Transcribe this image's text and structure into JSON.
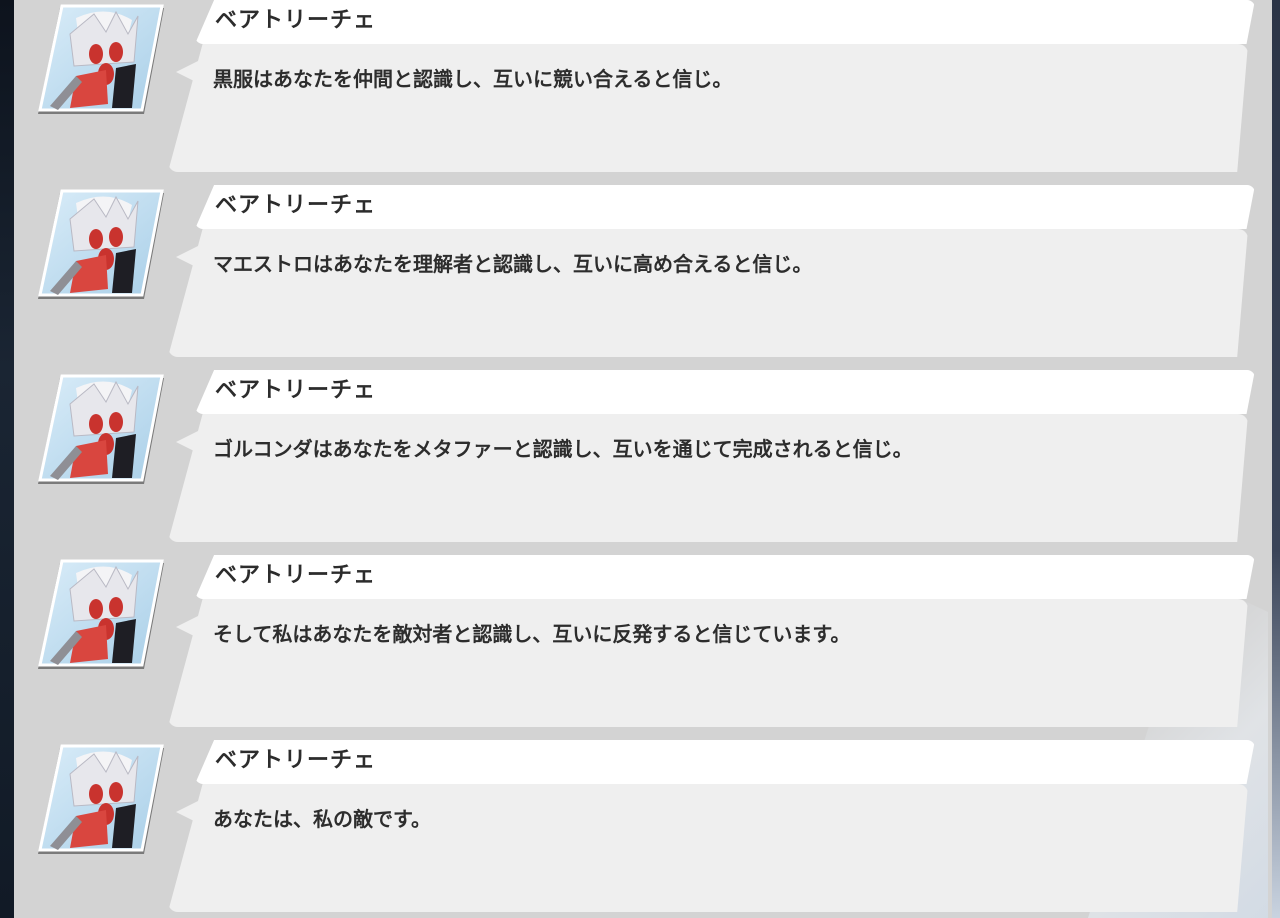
{
  "messages": [
    {
      "speaker": "ベアトリーチェ",
      "text": "黒服はあなたを仲間と認識し、互いに競い合えると信じ。"
    },
    {
      "speaker": "ベアトリーチェ",
      "text": "マエストロはあなたを理解者と認識し、互いに高め合えると信じ。"
    },
    {
      "speaker": "ベアトリーチェ",
      "text": "ゴルコンダはあなたをメタファーと認識し、互いを通じて完成されると信じ。"
    },
    {
      "speaker": "ベアトリーチェ",
      "text": "そして私はあなたを敵対者と認識し、互いに反発すると信じています。"
    },
    {
      "speaker": "ベアトリーチェ",
      "text": "あなたは、私の敵です。"
    }
  ],
  "colors": {
    "panel": "#d3d3d3",
    "name_bar": "#ffffff",
    "bubble": "#efefef",
    "text": "#2d2d2d",
    "avatar_accent": "#d9463f"
  }
}
